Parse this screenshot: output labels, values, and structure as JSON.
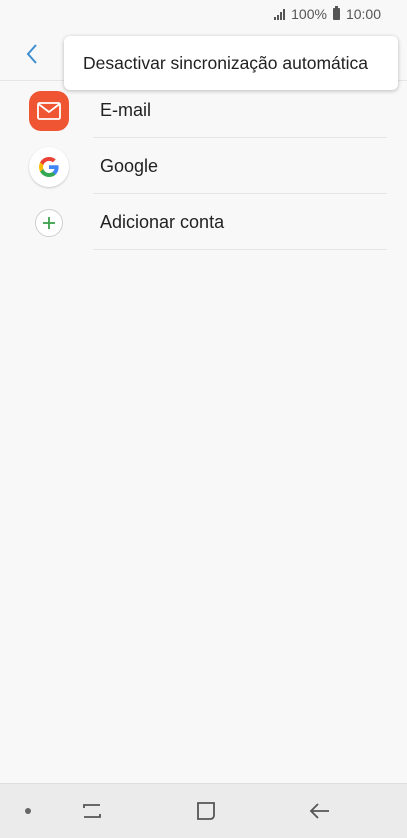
{
  "status_bar": {
    "battery": "100%",
    "time": "10:00"
  },
  "menu": {
    "item_label": "Desactivar sincronização automática"
  },
  "accounts": [
    {
      "label": "E-mail",
      "icon": "email-icon",
      "color": "#ef5533"
    },
    {
      "label": "Google",
      "icon": "google-icon"
    },
    {
      "label": "Adicionar conta",
      "icon": "add-icon",
      "color": "#3aa24a"
    }
  ],
  "colors": {
    "back_arrow": "#3e8fd1",
    "background": "#f8f8f8"
  }
}
